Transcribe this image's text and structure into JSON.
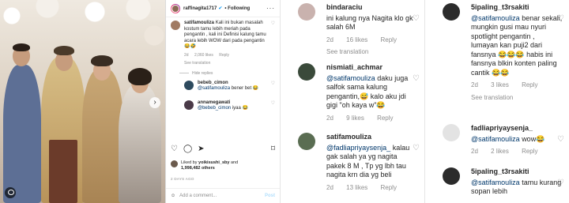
{
  "post": {
    "username": "raffinagita1717",
    "following_label": "• Following",
    "comments": [
      {
        "username": "satifamouliza",
        "text": "Kali ini bukan masalah kostum tamu lebih meriah pada pengantin , kali ini Definisi kalung tamu acara lebih WOW dari pada pengantin 😂🤣",
        "time": "2d",
        "likes": "2,060 likes",
        "reply": "Reply",
        "translation": "See translation"
      }
    ],
    "hide_replies": "Hide replies",
    "replies": [
      {
        "username": "bebeb_cimon",
        "mention": "@satifamouliza",
        "text": "bener bet 😂"
      },
      {
        "username": "annamegawati",
        "mention": "@bebeb_cimon",
        "text": "iyaa 😂"
      }
    ],
    "liked_by_prefix": "Liked by",
    "liked_by_user": "yoikisushi_sby",
    "liked_by_and": "and",
    "liked_by_count": "1,998,482 others",
    "date": "2 DAYS AGO",
    "add_comment": "Add a comment...",
    "post_button": "Post"
  },
  "thread_left": [
    {
      "username": "bindaraciu",
      "text": "ini kalung nya Nagita klo gk salah 6M",
      "time": "2d",
      "likes": "16 likes",
      "reply": "Reply",
      "translation": "See translation"
    },
    {
      "username": "nismiati_achmar",
      "mention": "@satifamouliza",
      "text": "daku juga salfok sama kalung pengantin,😅 kalo aku jdi gigi \"oh kaya w\"😂",
      "time": "2d",
      "likes": "9 likes",
      "reply": "Reply"
    },
    {
      "username": "satifamouliza",
      "mention": "@fadliapriyaysenja_",
      "text": "kalau gak salah ya yg nagita pakek 8 M , Tp yg lbh tau nagita krn dia yg beli",
      "time": "2d",
      "likes": "13 likes",
      "reply": "Reply"
    }
  ],
  "thread_right": [
    {
      "username": "5ipaling_t3rsakiti",
      "mention": "@satifamouliza",
      "text": "benar sekali, mungkin gusi mau nyuri spotlight pengantin , lumayan kan puji2 dari fansnya 😂😂😂 habis ini fansnya blkin konten paling cantik 😂😂",
      "time": "2d",
      "likes": "3 likes",
      "reply": "Reply",
      "translation": "See translation"
    },
    {
      "username": "fadliapriyaysenja_",
      "mention": "@satifamouliza",
      "text": "wow😂",
      "time": "2d",
      "likes": "2 likes",
      "reply": "Reply"
    },
    {
      "username": "5ipaling_t3rsakiti",
      "mention": "@satifamouliza",
      "text": "tamu kurang sopan lebih"
    }
  ],
  "colors": {
    "mention": "#00376b",
    "muted": "#8e8e8e",
    "verified": "#0095f6",
    "post_button": "#b3dffc"
  },
  "icons": [
    "heart-icon",
    "comment-icon",
    "share-icon",
    "bookmark-icon",
    "emoji-icon",
    "more-icon",
    "verified-icon",
    "chevron-right-icon",
    "user-tag-icon"
  ]
}
